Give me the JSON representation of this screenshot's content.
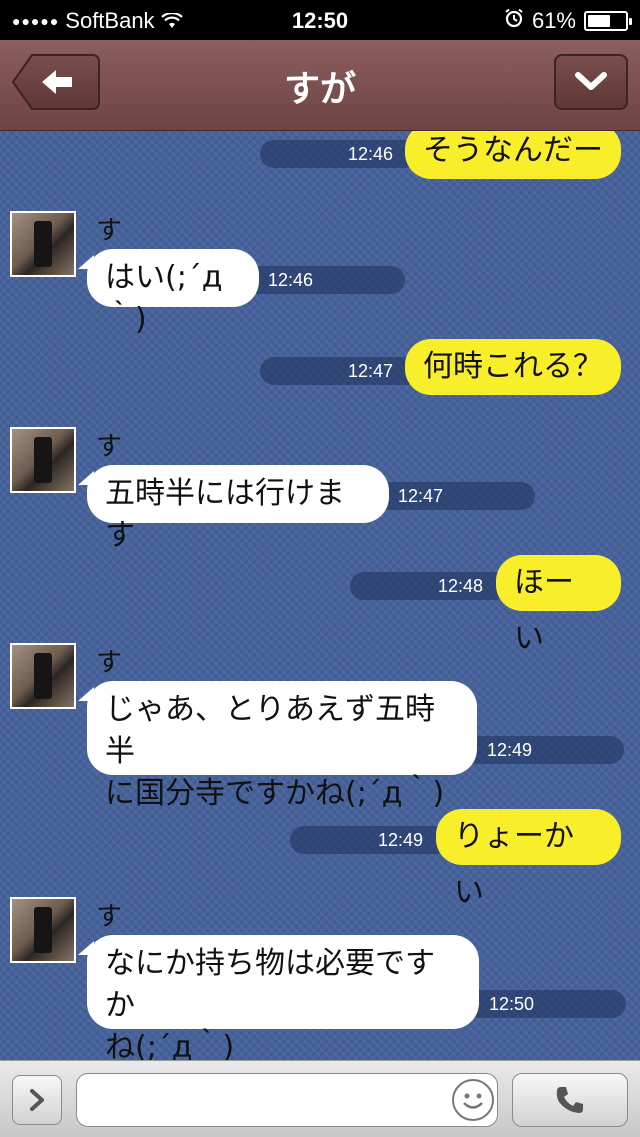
{
  "status_bar": {
    "signal": "●●●●●",
    "carrier": "SoftBank",
    "time": "12:50",
    "battery_text": "61%",
    "battery_level": 0.61
  },
  "header": {
    "title": "すが",
    "back_icon": "arrow-left-icon",
    "menu_icon": "chevron-down-icon"
  },
  "messages": [
    {
      "side": "out",
      "text": "そうなんだー",
      "time": "12:46"
    },
    {
      "side": "in",
      "sender": "すが",
      "text": "はい(;´д｀)",
      "time": "12:46"
    },
    {
      "side": "out",
      "text": "何時これる？",
      "time": "12:47"
    },
    {
      "side": "in",
      "sender": "すが",
      "text": "五時半には行けます",
      "time": "12:47"
    },
    {
      "side": "out",
      "text": "ほーい",
      "time": "12:48"
    },
    {
      "side": "in",
      "sender": "すが",
      "text_line1": "じゃあ、とりあえず五時半",
      "text_line2": "に国分寺ですかね(;´д｀)",
      "time": "12:49"
    },
    {
      "side": "out",
      "text": "りょーかい",
      "time": "12:49"
    },
    {
      "side": "in",
      "sender": "すが",
      "text_line1": "なにか持ち物は必要ですか",
      "text_line2": "ね(;´д｀)",
      "time": "12:50"
    }
  ],
  "input_bar": {
    "input_value": "",
    "plus_icon": "chevron-right-icon",
    "emoji_icon": "smiley-icon",
    "call_icon": "phone-icon"
  },
  "colors": {
    "navbar": "#7a4e4e",
    "chat_background": "#46629b",
    "outgoing_bubble": "#f9ee2a",
    "incoming_bubble": "#ffffff"
  }
}
